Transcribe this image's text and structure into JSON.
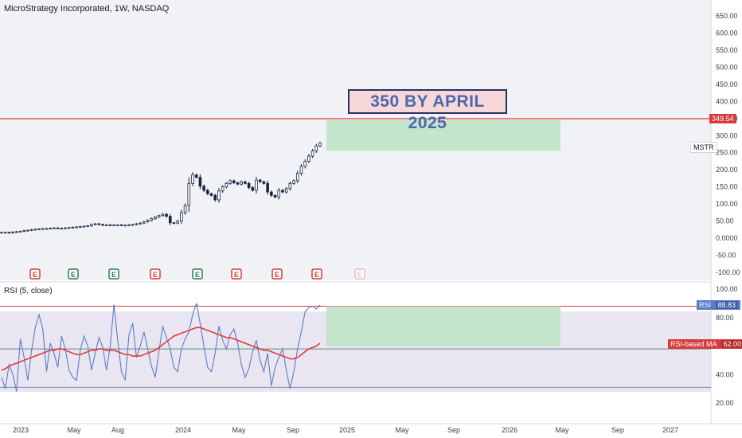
{
  "header": {
    "symbol_title": "MicroStrategy Incorporated, 1W, NASDAQ",
    "rsi_title": "RSI (5, close)",
    "mstr_tag": "MSTR"
  },
  "annotation": {
    "text": "350 BY APRIL 2025"
  },
  "labels": {
    "target_price": "349.54",
    "rsi_name": "RSI",
    "rsi_value": "88.83",
    "rsi_ma_name": "RSI-based MA",
    "rsi_ma_value": "62.00"
  },
  "colors": {
    "up": "#ffffff",
    "down": "#1c2444",
    "target_line": "#d93a3a",
    "projection_fill": "#bfe3c6",
    "rsi_line": "#5b7cc9",
    "rsi_ma_line": "#e03a3a",
    "annotation_bg": "#f7d7d9",
    "annotation_text": "#4a68ad"
  },
  "chart_data": [
    {
      "type": "candlestick",
      "title": "MicroStrategy Incorporated, 1W, NASDAQ",
      "interval": "1W",
      "x_ticks": [
        "2023",
        "May",
        "Aug",
        "2024",
        "May",
        "Sep",
        "2025",
        "May",
        "Sep",
        "2026",
        "May",
        "Sep",
        "2027"
      ],
      "y_ticks": [
        "650.00",
        "600.00",
        "550.00",
        "500.00",
        "450.00",
        "400.00",
        "350.00",
        "300.00",
        "250.00",
        "200.00",
        "150.00",
        "100.00",
        "50.00",
        "0.0000",
        "-50.00",
        "-100.00"
      ],
      "ylim": [
        -100,
        650
      ],
      "close": [
        17,
        17,
        16,
        18,
        19,
        20,
        22,
        23,
        25,
        26,
        27,
        28,
        28,
        29,
        30,
        29,
        29,
        30,
        31,
        32,
        33,
        34,
        35,
        36,
        40,
        42,
        40,
        38,
        39,
        38,
        39,
        39,
        38,
        38,
        39,
        40,
        42,
        44,
        48,
        52,
        57,
        62,
        66,
        70,
        64,
        45,
        44,
        50,
        75,
        95,
        160,
        185,
        178,
        152,
        140,
        130,
        125,
        112,
        138,
        150,
        160,
        168,
        162,
        158,
        165,
        160,
        148,
        140,
        170,
        165,
        160,
        135,
        125,
        120,
        140,
        135,
        145,
        160,
        168,
        190,
        210,
        225,
        240,
        255,
        270,
        278
      ],
      "target_level": 349.54,
      "symbol": "MSTR",
      "earnings_markers": [
        "E",
        "E",
        "E",
        "E",
        "E",
        "E",
        "E",
        "E",
        "E"
      ],
      "projection": {
        "start": "2024-11",
        "end": "2026-05",
        "low": 255,
        "high": 345
      },
      "annotation": "350 BY APRIL 2025"
    },
    {
      "type": "line",
      "title": "RSI (5, close)",
      "y_ticks": [
        "100.00",
        "80.00",
        "60.00",
        "40.00",
        "20.00"
      ],
      "ylim": [
        15,
        100
      ],
      "levels": [
        88,
        58,
        31
      ],
      "series": [
        {
          "name": "RSI",
          "last": 88.83,
          "values": [
            38,
            30,
            47,
            40,
            28,
            65,
            52,
            36,
            57,
            73,
            82,
            72,
            42,
            62,
            55,
            45,
            67,
            58,
            43,
            38,
            36,
            57,
            67,
            60,
            43,
            55,
            66,
            59,
            43,
            60,
            89,
            64,
            42,
            36,
            68,
            76,
            52,
            60,
            70,
            58,
            46,
            38,
            56,
            74,
            66,
            58,
            45,
            42,
            58,
            65,
            70,
            82,
            90,
            76,
            60,
            45,
            42,
            55,
            74,
            64,
            58,
            68,
            72,
            62,
            47,
            38,
            44,
            56,
            64,
            50,
            42,
            55,
            32,
            45,
            52,
            58,
            43,
            30,
            42,
            58,
            70,
            84,
            87,
            88,
            86,
            88.83
          ]
        },
        {
          "name": "RSI-based MA",
          "last": 62.0,
          "values": [
            43,
            44,
            46,
            47,
            48,
            49,
            50,
            51,
            52,
            53,
            54,
            55,
            56,
            57,
            57,
            58,
            58,
            57,
            56,
            55,
            54,
            54,
            55,
            56,
            57,
            57,
            58,
            58,
            57,
            57,
            57,
            56,
            55,
            54,
            54,
            53,
            53,
            53,
            54,
            55,
            56,
            57,
            59,
            61,
            63,
            65,
            67,
            68,
            69,
            70,
            71,
            72,
            73,
            73,
            72,
            71,
            70,
            69,
            68,
            67,
            66,
            66,
            65,
            64,
            63,
            62,
            61,
            60,
            59,
            58,
            57,
            57,
            56,
            55,
            54,
            53,
            52,
            51,
            51,
            52,
            54,
            56,
            58,
            59,
            60,
            62.0
          ]
        }
      ]
    }
  ]
}
